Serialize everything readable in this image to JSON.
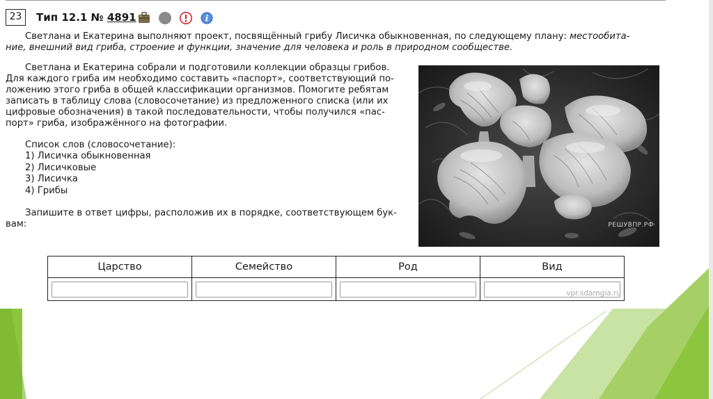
{
  "task": {
    "number": "23",
    "type_prefix": "Тип 12.1 № ",
    "id_link": "4891"
  },
  "icons": {
    "bag": "briefcase-icon",
    "circle": "grey-circle-icon",
    "warning": "exclamation-icon",
    "info": "info-icon",
    "colors": {
      "warning": "#d9252b",
      "info": "#2f6fc9",
      "circle": "#8a8a8a",
      "accent_green": "#8cc63f"
    }
  },
  "intro": {
    "line1_plain": "Светлана и Екатерина выполняют проект, посвящённый грибу Лисичка обыкновенная, по следующему плану: ",
    "line1_italic": "местообита-",
    "line2_italic": "ние, внешний вид гриба, строение и функции, значение для человека и роль в природном сообществе."
  },
  "body_lines": [
    "Светлана и Екатерина собрали и подготовили коллекции образцы грибов.",
    "Для каждого гриба им необходимо составить «паспорт», соответствующий по-",
    "ложению этого гриба в общей классификации организмов. Помогите ребятам",
    "записать в таблицу слова (словосочетание) из предложенного списка (или их",
    "цифровые обозначения) в такой последовательности, чтобы получился «пас-",
    "порт» гриба, изображённого на фотографии."
  ],
  "word_list": {
    "heading": "Список слов (словосочетание):",
    "items": [
      "1) Лисичка обыкновенная",
      "2) Лисичковые",
      "3) Лисичка",
      "4) Грибы"
    ]
  },
  "instruction_lines": [
    "Запишите в ответ цифры, расположив их в порядке, соответствующем бук-",
    "вам:"
  ],
  "photo": {
    "watermark": "РЕШУВПР.РФ"
  },
  "table": {
    "headers": [
      "Царство",
      "Семейство",
      "Род",
      "Вид"
    ],
    "values": [
      "",
      "",
      "",
      ""
    ]
  },
  "site_watermark": "vpr.sdamgia.ru"
}
